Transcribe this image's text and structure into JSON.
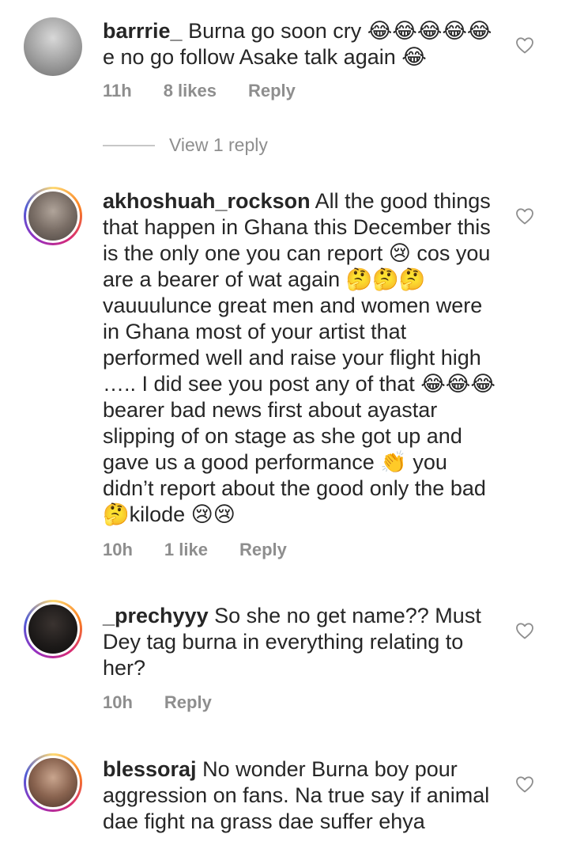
{
  "comments": [
    {
      "username": "barrrie_",
      "text": "Burna go soon cry 😂😂😂😂😂 e no go follow Asake talk again 😂",
      "time": "11h",
      "likes": "8 likes",
      "reply_label": "Reply",
      "view_replies": "View 1 reply",
      "avatar_color": "#9a9a9a"
    },
    {
      "username": "akhoshuah_rockson",
      "text": "All the good things that happen in Ghana this December this is the only one you can report 😢 cos you are a bearer of wat again 🤔🤔🤔vauuulunce great men and women were in Ghana most of your artist that performed well and raise your flight high ….. I did see you post any of that 😂😂😂 bearer bad news first about ayastar slipping of on stage as she got up and gave us a good performance 👏 you didn’t report about the good only the bad 🤔kilode 😢😢",
      "time": "10h",
      "likes": "1 like",
      "reply_label": "Reply",
      "avatar_color": "#6b6560"
    },
    {
      "username": "_prechyyy",
      "text": "So she no get name?? Must Dey tag burna in everything relating to her?",
      "time": "10h",
      "reply_label": "Reply",
      "avatar_color": "#1c1c1c"
    },
    {
      "username": "blessoraj",
      "text": "No wonder Burna boy pour aggression on fans. Na true say if animal dae fight na grass dae suffer ehya",
      "avatar_color": "#7a5a4a"
    }
  ],
  "icons": {
    "like": "heart-outline-icon"
  },
  "colors": {
    "meta": "#8e8e8e",
    "text": "#262626",
    "heart": "#8e8e8e"
  }
}
